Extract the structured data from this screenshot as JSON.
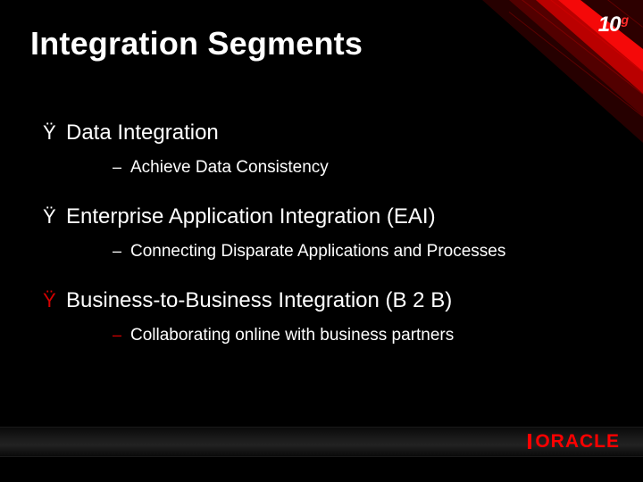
{
  "slide": {
    "title": "Integration Segments",
    "logo10g": {
      "ten": "10",
      "g": "g"
    },
    "bullets": [
      {
        "marker": "Ÿ",
        "markerColor": "white",
        "text": "Data Integration",
        "sub": {
          "marker": "–",
          "markerColor": "white",
          "text": "Achieve Data Consistency"
        }
      },
      {
        "marker": "Ÿ",
        "markerColor": "white",
        "text": "Enterprise Application Integration (EAI)",
        "sub": {
          "marker": "–",
          "markerColor": "white",
          "text": "Connecting Disparate Applications and Processes"
        }
      },
      {
        "marker": "Ÿ",
        "markerColor": "red",
        "text": "Business-to-Business Integration (B 2 B)",
        "sub": {
          "marker": "–",
          "markerColor": "red",
          "text": "Collaborating online with business partners"
        }
      }
    ],
    "footer": {
      "brand": "ORACLE"
    }
  }
}
